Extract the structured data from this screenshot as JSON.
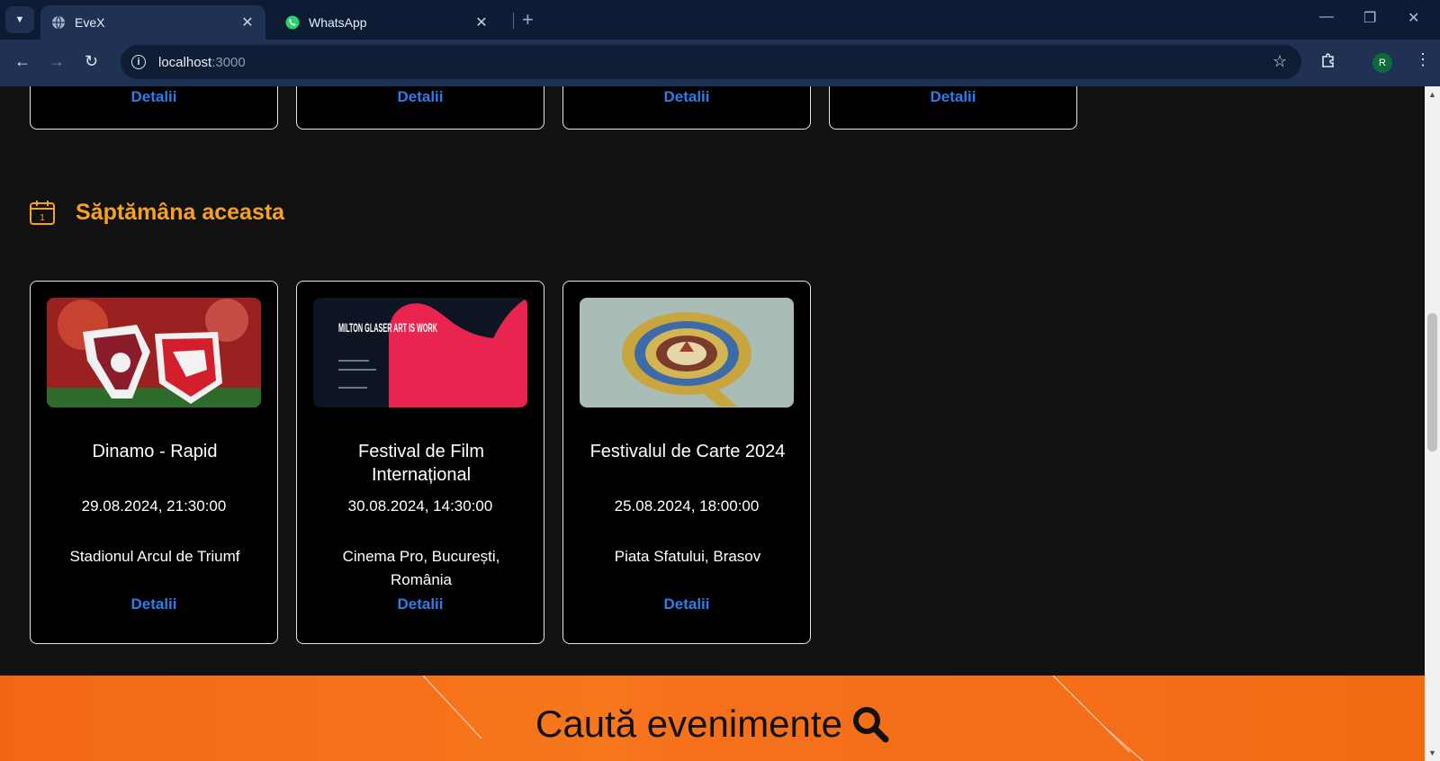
{
  "browser": {
    "tabs": [
      {
        "title": "EveX",
        "active": true
      },
      {
        "title": "WhatsApp",
        "active": false
      }
    ],
    "url_host": "localhost",
    "url_port": ":3000",
    "profile_initial": "R"
  },
  "top_cards": [
    {
      "details_label": "Detalii"
    },
    {
      "details_label": "Detalii"
    },
    {
      "details_label": "Detalii"
    },
    {
      "details_label": "Detalii"
    }
  ],
  "section": {
    "title": "Săptămâna aceasta",
    "calendar_day": "1",
    "accent_color": "#f7a21b"
  },
  "events": [
    {
      "title": "Dinamo - Rapid",
      "date": "29.08.2024, 21:30:00",
      "location": "Stadionul Arcul de Triumf",
      "details_label": "Detalii"
    },
    {
      "title": "Festival de Film Internațional",
      "date": "30.08.2024, 14:30:00",
      "location": "Cinema Pro, București, România",
      "details_label": "Detalii",
      "poster_text": "MILTON GLASER ART IS WORK"
    },
    {
      "title": "Festivalul de Carte 2024",
      "date": "25.08.2024, 18:00:00",
      "location": "Piata Sfatului, Brasov",
      "details_label": "Detalii"
    }
  ],
  "banner": {
    "title": "Caută evenimente",
    "icon": "search-icon"
  },
  "colors": {
    "link": "#2b7de9",
    "banner": "#f26716",
    "page_bg": "#111111"
  }
}
